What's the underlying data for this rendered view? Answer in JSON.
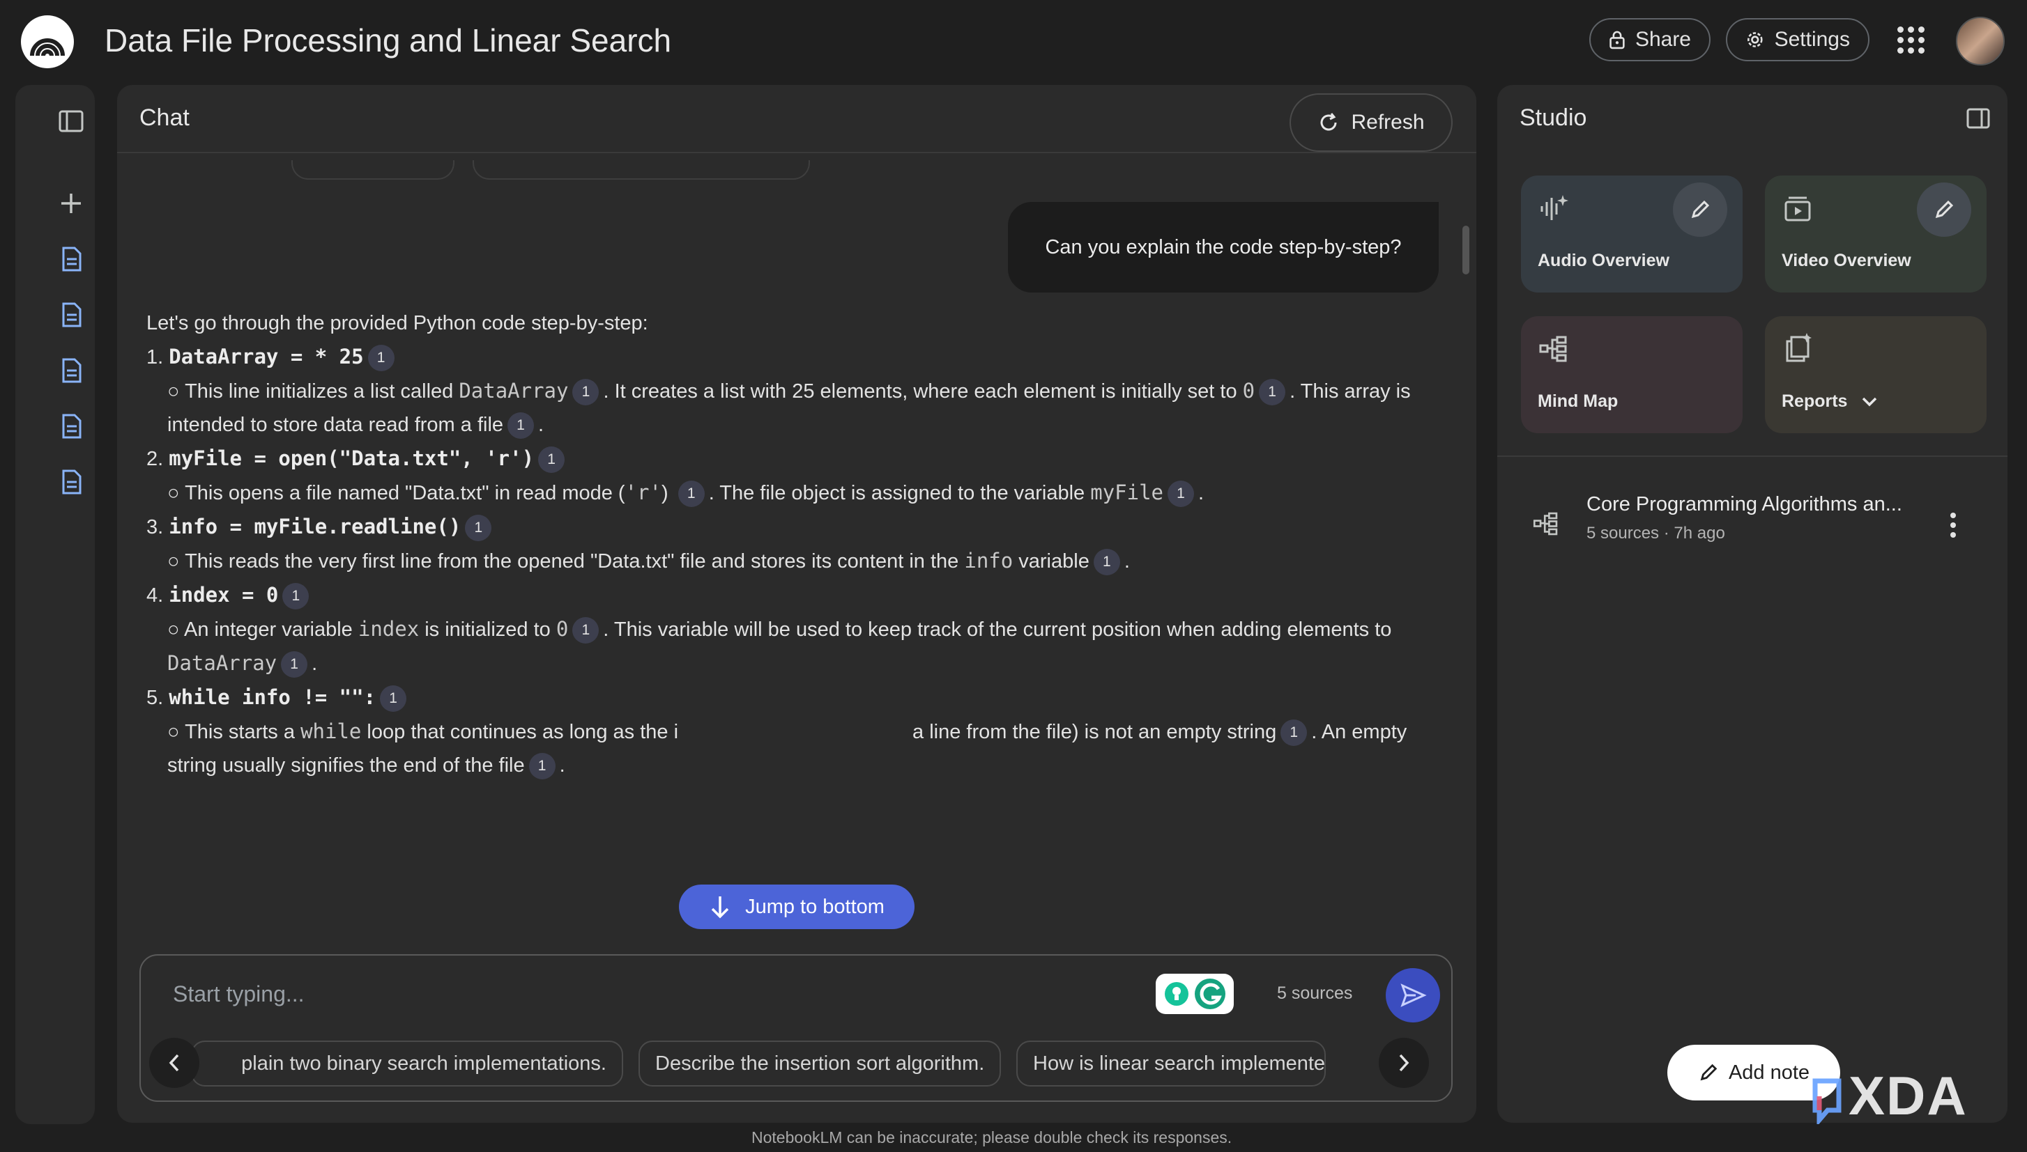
{
  "header": {
    "title": "Data File Processing and Linear Search",
    "share_label": "Share",
    "settings_label": "Settings"
  },
  "chat": {
    "title": "Chat",
    "refresh_label": "Refresh",
    "user_message": "Can you explain the code step-by-step?",
    "intro": "Let's go through the provided Python code step-by-step:",
    "citation": "1",
    "steps": [
      {
        "num": "1.",
        "code": "DataArray =  * 25",
        "t1": "This line initializes a list called ",
        "c1": "DataArray",
        "t2": ". It creates a list with 25 elements, where each element is initially set to ",
        "c2": "0",
        "t3": ". This array is intended to store data read from a file"
      },
      {
        "num": "2.",
        "code": "myFile = open(\"Data.txt\", 'r')",
        "t1": "This opens a file named \"Data.txt\" in read mode (",
        "c1": "'r'",
        "t2": ") ",
        "t3": ". The file object is assigned to the variable ",
        "c2": "myFile"
      },
      {
        "num": "3.",
        "code": "info = myFile.readline()",
        "t1": "This reads the very first line from the opened \"Data.txt\" file and stores its content in the ",
        "c1": "info",
        "t2": " variable"
      },
      {
        "num": "4.",
        "code": "index = 0",
        "t1": "An integer variable ",
        "c1": "index",
        "t2": " is initialized to ",
        "c2": "0",
        "t3": ". This variable will be used to keep track of the current position when adding elements to ",
        "c3": "DataArray"
      },
      {
        "num": "5.",
        "code": "while info != \"\":",
        "t1": "This starts a ",
        "c1": "while",
        "t2": " loop that continues as long as the ",
        "t3": "i",
        "t4": "a line from the file) is not an empty string",
        "t5": ". An empty string usually signifies the end of the file"
      }
    ],
    "jump_label": "Jump to bottom",
    "input_placeholder": "Start typing...",
    "sources_count": "5 sources",
    "suggestions": [
      "plain two binary search implementations.",
      "Describe the insertion sort algorithm.",
      "How is linear search implemente"
    ],
    "disclaimer": "NotebookLM can be inaccurate; please double check its responses."
  },
  "studio": {
    "title": "Studio",
    "cards": [
      "Audio Overview",
      "Video Overview",
      "Mind Map",
      "Reports"
    ],
    "note": {
      "title": "Core Programming Algorithms an...",
      "meta": "5 sources · 7h ago"
    },
    "add_note_label": "Add note"
  },
  "watermark": "XDA",
  "colors": {
    "accent": "#4c64d8",
    "send": "#3b4dbf",
    "background": "#1f1f1f",
    "panel": "#2b2b2b"
  }
}
